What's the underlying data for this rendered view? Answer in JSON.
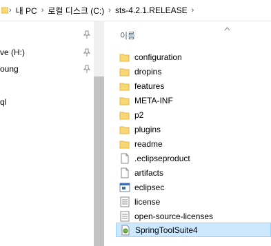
{
  "breadcrumb": {
    "items": [
      "내 PC",
      "로컬 디스크 (C:)",
      "sts-4.2.1.RELEASE"
    ]
  },
  "nav": {
    "items": [
      {
        "label": "ve (H:)",
        "pinned": true
      },
      {
        "label": "oung",
        "pinned": true
      },
      {
        "label": "",
        "pinned": false
      },
      {
        "label": "ql",
        "pinned": false
      }
    ]
  },
  "content": {
    "column_header": "이름",
    "files": [
      {
        "name": "configuration",
        "type": "folder"
      },
      {
        "name": "dropins",
        "type": "folder"
      },
      {
        "name": "features",
        "type": "folder"
      },
      {
        "name": "META-INF",
        "type": "folder"
      },
      {
        "name": "p2",
        "type": "folder"
      },
      {
        "name": "plugins",
        "type": "folder"
      },
      {
        "name": "readme",
        "type": "folder"
      },
      {
        "name": ".eclipseproduct",
        "type": "file"
      },
      {
        "name": "artifacts",
        "type": "file"
      },
      {
        "name": "eclipsec",
        "type": "exe"
      },
      {
        "name": "license",
        "type": "text"
      },
      {
        "name": "open-source-licenses",
        "type": "text"
      },
      {
        "name": "SpringToolSuite4",
        "type": "app"
      }
    ],
    "selected_index": 12
  },
  "colors": {
    "selection_bg": "#cce8ff",
    "selection_border": "#99d1ff",
    "folder": "#f8d775",
    "folder_dark": "#e6b53e",
    "header_text": "#4c607a"
  }
}
